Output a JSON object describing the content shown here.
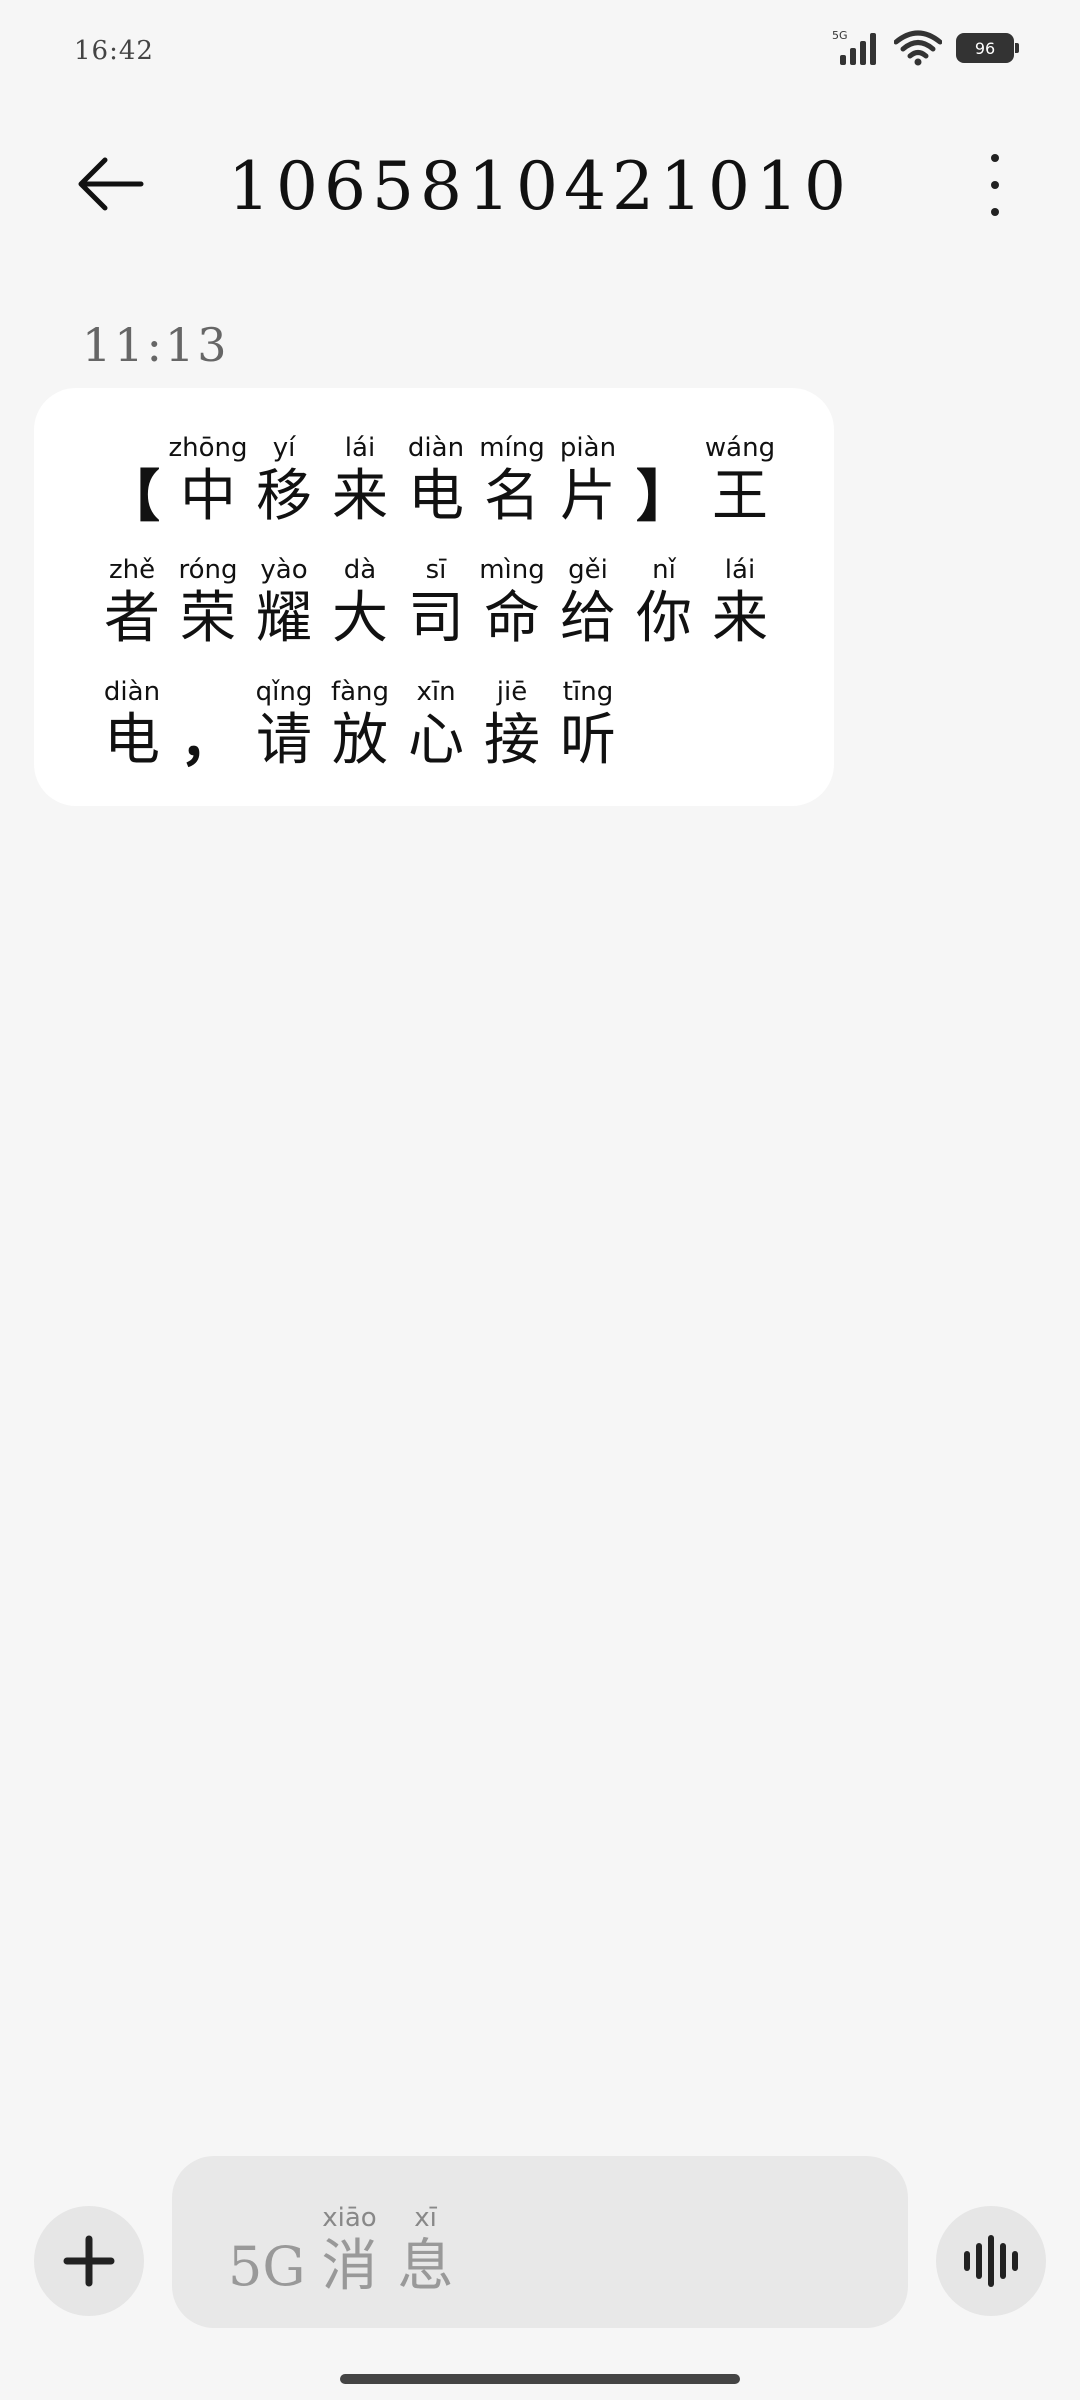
{
  "status_bar": {
    "time": "16:42",
    "network_label": "5G",
    "battery": "96",
    "icons": [
      "signal-icon",
      "wifi-icon",
      "battery-icon"
    ]
  },
  "header": {
    "title": "1065810421010",
    "back_icon": "arrow-left-icon",
    "more_icon": "more-vertical-icon"
  },
  "conversation": {
    "message_time": "11:13",
    "message": {
      "lines": [
        [
          {
            "hz": "【",
            "py": ""
          },
          {
            "hz": "中",
            "py": "zhōng"
          },
          {
            "hz": "移",
            "py": "yí"
          },
          {
            "hz": "来",
            "py": "lái"
          },
          {
            "hz": "电",
            "py": "diàn"
          },
          {
            "hz": "名",
            "py": "míng"
          },
          {
            "hz": "片",
            "py": "piàn"
          },
          {
            "hz": "】",
            "py": ""
          },
          {
            "hz": "王",
            "py": "wáng"
          }
        ],
        [
          {
            "hz": "者",
            "py": "zhě"
          },
          {
            "hz": "荣",
            "py": "róng"
          },
          {
            "hz": "耀",
            "py": "yào"
          },
          {
            "hz": "大",
            "py": "dà"
          },
          {
            "hz": "司",
            "py": "sī"
          },
          {
            "hz": "命",
            "py": "mìng"
          },
          {
            "hz": "给",
            "py": "gěi"
          },
          {
            "hz": "你",
            "py": "nǐ"
          },
          {
            "hz": "来",
            "py": "lái"
          }
        ],
        [
          {
            "hz": "电",
            "py": "diàn"
          },
          {
            "hz": "，",
            "py": ""
          },
          {
            "hz": "请",
            "py": "qǐng"
          },
          {
            "hz": "放",
            "py": "fàng"
          },
          {
            "hz": "心",
            "py": "xīn"
          },
          {
            "hz": "接",
            "py": "jiē"
          },
          {
            "hz": "听",
            "py": "tīng"
          }
        ]
      ]
    }
  },
  "composer": {
    "add_icon": "plus-icon",
    "voice_icon": "voice-wave-icon",
    "placeholder_prefix": "5G",
    "placeholder_chars": [
      {
        "hz": "消",
        "py": "xiāo"
      },
      {
        "hz": "息",
        "py": "xī"
      }
    ]
  }
}
